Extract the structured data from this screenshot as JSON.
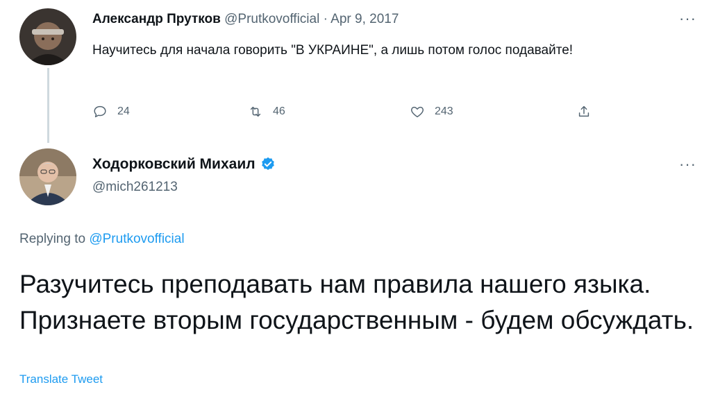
{
  "tweet1": {
    "author_name": "Александр Прутков",
    "handle": "@Prutkovofficial",
    "separator": "·",
    "date": "Apr 9, 2017",
    "text": "Научитесь для начала говорить \"В УКРАИНЕ\", а лишь потом голос подавайте!",
    "actions": {
      "replies": "24",
      "retweets": "46",
      "likes": "243"
    },
    "more_label": "···"
  },
  "tweet2": {
    "author_name": "Ходорковский Михаил",
    "verified": true,
    "handle": "@mich261213",
    "more_label": "···",
    "replying_prefix": "Replying to",
    "replying_handle": "@Prutkovofficial",
    "text": "Разучитесь преподавать нам правила нашего языка. Признаете вторым государственным - будем обсуждать.",
    "translate_label": "Translate Tweet"
  },
  "colors": {
    "link": "#1d9bf0",
    "secondary_text": "#536471",
    "primary_text": "#0f1419",
    "thread_line": "#cfd9de"
  },
  "icons": [
    "reply-icon",
    "retweet-icon",
    "like-icon",
    "share-icon",
    "verified-badge-icon",
    "more-icon"
  ]
}
